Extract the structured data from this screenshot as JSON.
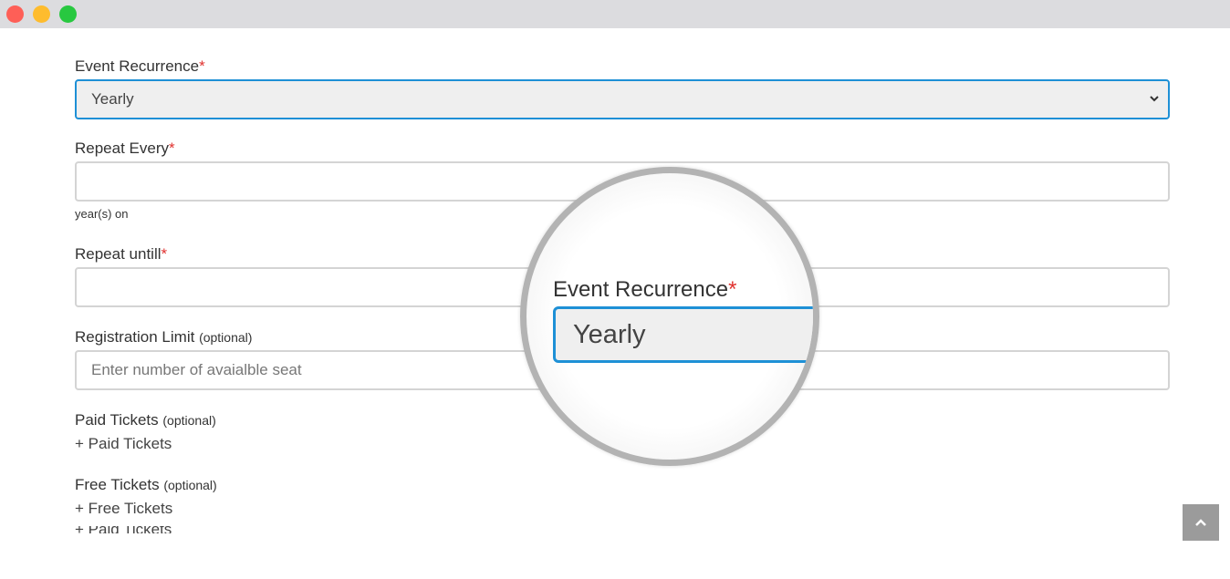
{
  "window": {
    "controls": [
      "close",
      "minimize",
      "maximize"
    ]
  },
  "form": {
    "event_recurrence": {
      "label": "Event Recurrence",
      "required_mark": "*",
      "value": "Yearly"
    },
    "repeat_every": {
      "label": "Repeat Every",
      "required_mark": "*",
      "value": "",
      "hint": "year(s) on"
    },
    "repeat_until": {
      "label": "Repeat untill",
      "required_mark": "*",
      "value": ""
    },
    "registration_limit": {
      "label": "Registration Limit",
      "optional": "(optional)",
      "placeholder": "Enter number of avaialble seat"
    },
    "paid_tickets": {
      "label": "Paid Tickets",
      "optional": "(optional)",
      "add_link": "+ Paid Tickets"
    },
    "free_tickets": {
      "label": "Free Tickets",
      "optional": "(optional)",
      "add_link": "+ Free Tickets"
    },
    "clipped_text": "+ Paid Tickets"
  },
  "magnifier": {
    "label": "Event Recurrence",
    "required_mark": "*",
    "value": "Yearly"
  },
  "icons": {
    "select_arrow": "chevron-down-icon",
    "scroll_top": "chevron-up-icon"
  },
  "colors": {
    "accent": "#1e90d6",
    "required": "#e0322f",
    "titlebar": "#dcdcdf",
    "scroll_button": "#9b9b9b"
  }
}
